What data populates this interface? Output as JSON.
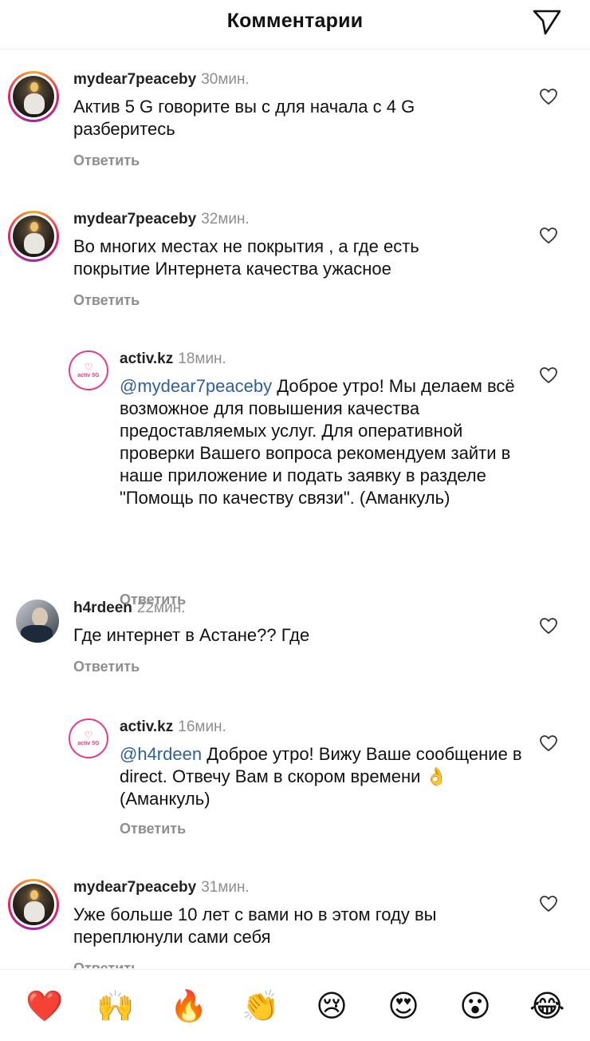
{
  "header": {
    "title": "Комментарии",
    "share_icon": "send-icon"
  },
  "comments": [
    {
      "user": "mydear7peaceby",
      "time": "30мин.",
      "text": "Актив 5 G говорите вы с для начала с 4 G разберитесь",
      "reply_label": "Ответить"
    },
    {
      "user": "mydear7peaceby",
      "time": "32мин.",
      "text": "Во многих местах не покрытия , а где есть покрытие Интернета качества ужасное",
      "reply_label": "Ответить"
    },
    {
      "user": "activ.kz",
      "time": "18мин.",
      "mention": "@mydear7peaceby",
      "text": "Доброе утро! Мы делаем всё возможное для повышения качества предоставляемых услуг. Для оперативной проверки Вашего вопроса рекомендуем зайти в наше приложение и подать заявку в разделе \"Помощь по качеству связи\". (Аманкуль)",
      "reply_label": "Ответить",
      "avatar_text": "activ 5G"
    },
    {
      "user": "h4rdeen",
      "time": "22мин.",
      "text": "Где интернет в Астане?? Где",
      "reply_label": "Ответить"
    },
    {
      "user": "activ.kz",
      "time": "16мин.",
      "mention": "@h4rdeen",
      "text": "Доброе утро! Вижу Ваше сообщение в direct. Отвечу Вам в скором времени 👌 (Аманкуль)",
      "reply_label": "Ответить",
      "avatar_text": "activ 5G"
    },
    {
      "user": "mydear7peaceby",
      "time": "31мин.",
      "text": "Уже больше 10 лет с вами но в этом году вы переплюнули сами себя",
      "reply_label": "Ответить"
    }
  ],
  "emoji_bar": [
    "❤️",
    "🙌",
    "🔥",
    "👏",
    "😢",
    "😍",
    "😮",
    "😂"
  ],
  "colors": {
    "mention": "#2f5f9d",
    "muted": "#8e8e8e",
    "brand": "#e63b8a"
  }
}
